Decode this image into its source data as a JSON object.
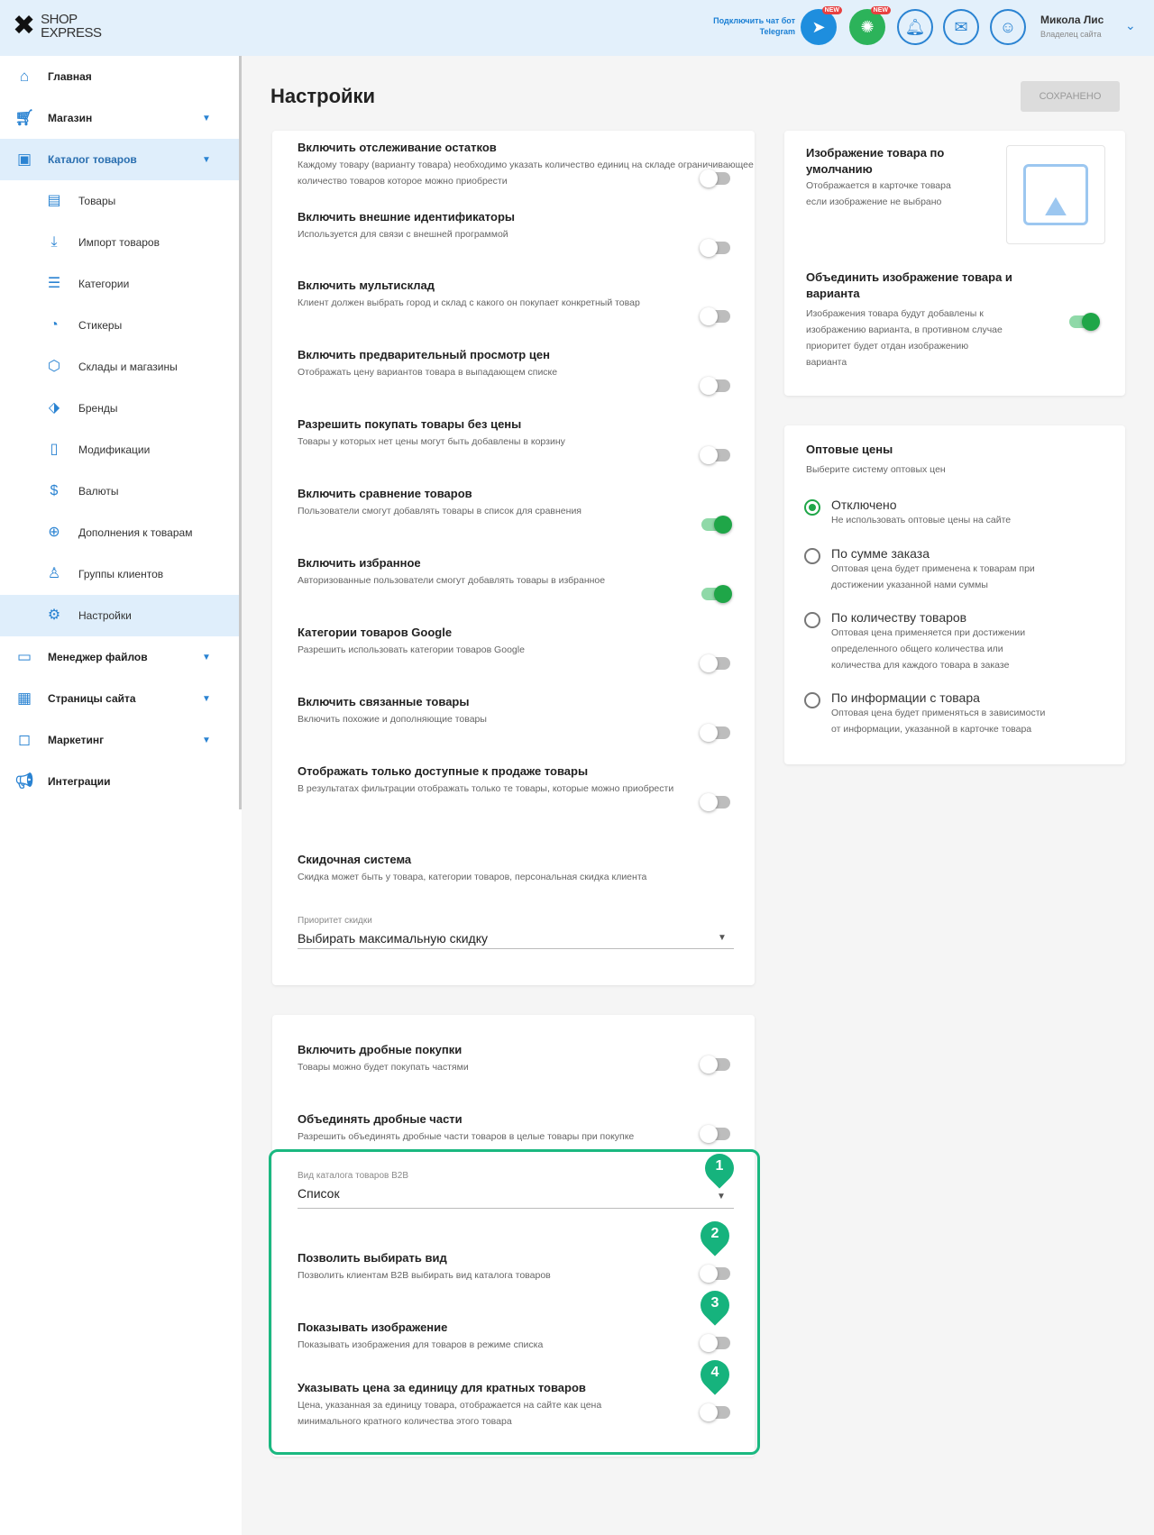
{
  "header": {
    "logo_top": "SHOP",
    "logo_bottom": "EXPRESS",
    "telegram_note_1": "Подключить чат бот",
    "telegram_note_2": "Telegram",
    "badge_new": "NEW",
    "user_name": "Микола Лис",
    "user_role": "Владелец сайта"
  },
  "sidebar": {
    "home": "Главная",
    "shop": "Магазин",
    "catalog": "Каталог товаров",
    "sub": {
      "goods": "Товары",
      "import": "Импорт товаров",
      "categories": "Категории",
      "stickers": "Стикеры",
      "warehouses": "Склады и магазины",
      "brands": "Бренды",
      "modifications": "Модификации",
      "currencies": "Валюты",
      "addons": "Дополнения к товарам",
      "client_groups": "Группы клиентов",
      "settings": "Настройки"
    },
    "file_manager": "Менеджер файлов",
    "site_pages": "Страницы сайта",
    "marketing": "Маркетинг",
    "integrations": "Интеграции"
  },
  "page": {
    "title": "Настройки",
    "save_label": "Сохранено"
  },
  "settings_card": {
    "rows": [
      {
        "title": "Включить отслеживание остатков",
        "desc": "Каждому товару (варианту товара) необходимо указать количество единиц на складе ограничивающее количество товаров которое можно приобрести",
        "on": false
      },
      {
        "title": "Включить внешние идентификаторы",
        "desc": "Используется для связи с внешней программой",
        "on": false
      },
      {
        "title": "Включить мультисклад",
        "desc": "Клиент должен выбрать город и склад с какого он покупает конкретный товар",
        "on": false
      },
      {
        "title": "Включить предварительный просмотр цен",
        "desc": "Отображать цену вариантов товара в выпадающем списке",
        "on": false
      },
      {
        "title": "Разрешить покупать товары без цены",
        "desc": "Товары у которых нет цены могут быть добавлены в корзину",
        "on": false
      },
      {
        "title": "Включить сравнение товаров",
        "desc": "Пользователи смогут добавлять товары в список для сравнения",
        "on": true
      },
      {
        "title": "Включить избранное",
        "desc": "Авторизованные пользователи смогут добавлять товары в избранное",
        "on": true
      },
      {
        "title": "Категории товаров Google",
        "desc": "Разрешить использовать категории товаров Google",
        "on": false
      },
      {
        "title": "Включить связанные товары",
        "desc": "Включить похожие и дополняющие товары",
        "on": false
      },
      {
        "title": "Отображать только доступные к продаже товары",
        "desc": "В результатах фильтрации отображать только те товары, которые можно приобрести",
        "on": false
      }
    ],
    "discount_title": "Скидочная система",
    "discount_desc": "Скидка может быть у товара, категории товаров, персональная скидка клиента",
    "discount_priority_label": "Приоритет скидки",
    "discount_priority_value": "Выбирать максимальную скидку"
  },
  "b2b_card": {
    "rows": [
      {
        "title": "Включить дробные покупки",
        "desc": "Товары можно будет покупать частями",
        "on": false
      },
      {
        "title": "Объединять дробные части",
        "desc": "Разрешить объединять дробные части товаров в целые товары при покупке",
        "on": false
      }
    ],
    "catalog_view_label": "Вид каталога товаров B2B",
    "catalog_view_value": "Список",
    "allow_view": {
      "title": "Позволить выбирать вид",
      "desc": "Позволить клиентам B2B выбирать вид каталога товаров",
      "on": false
    },
    "show_image": {
      "title": "Показывать изображение",
      "desc": "Показывать изображения для товаров в режиме списка",
      "on": false
    },
    "unit_price": {
      "title": "Указывать цена за единицу для кратных товаров",
      "desc1": "Цена, указанная за единицу товара, отображается на сайте как цена",
      "desc2": "минимального кратного количества этого товара",
      "on": false
    }
  },
  "markers": [
    "1",
    "2",
    "3",
    "4"
  ],
  "image_card": {
    "default_title_1": "Изображение товара по",
    "default_title_2": "умолчанию",
    "default_desc_1": "Отображается в карточке товара",
    "default_desc_2": "если изображение не выбрано",
    "merge_title_1": "Объединить изображение товара и",
    "merge_title_2": "варианта",
    "merge_desc_1": "Изображения товара будут добавлены к",
    "merge_desc_2": "изображению варианта, в противном случае",
    "merge_desc_3": "приоритет будет отдан изображению",
    "merge_desc_4": "варианта",
    "merge_on": true
  },
  "wholesale_card": {
    "title": "Оптовые цены",
    "subtitle": "Выберите систему оптовых цен",
    "options": [
      {
        "title": "Отключено",
        "desc": [
          "Не использовать оптовые цены на сайте"
        ],
        "selected": true
      },
      {
        "title": "По сумме заказа",
        "desc": [
          "Оптовая цена будет применена к товарам при",
          "достижении указанной нами суммы"
        ],
        "selected": false
      },
      {
        "title": "По количеству товаров",
        "desc": [
          "Оптовая цена применяется при достижении",
          "определенного общего количества или",
          "количества для каждого товара в заказе"
        ],
        "selected": false
      },
      {
        "title": "По информации с товара",
        "desc": [
          "Оптовая цена будет применяться в зависимости",
          "от информации, указанной в карточке товара"
        ],
        "selected": false
      }
    ]
  },
  "colors": {
    "accent": "#2a83d2",
    "green": "#1fa648",
    "highlight": "#1ab880"
  }
}
